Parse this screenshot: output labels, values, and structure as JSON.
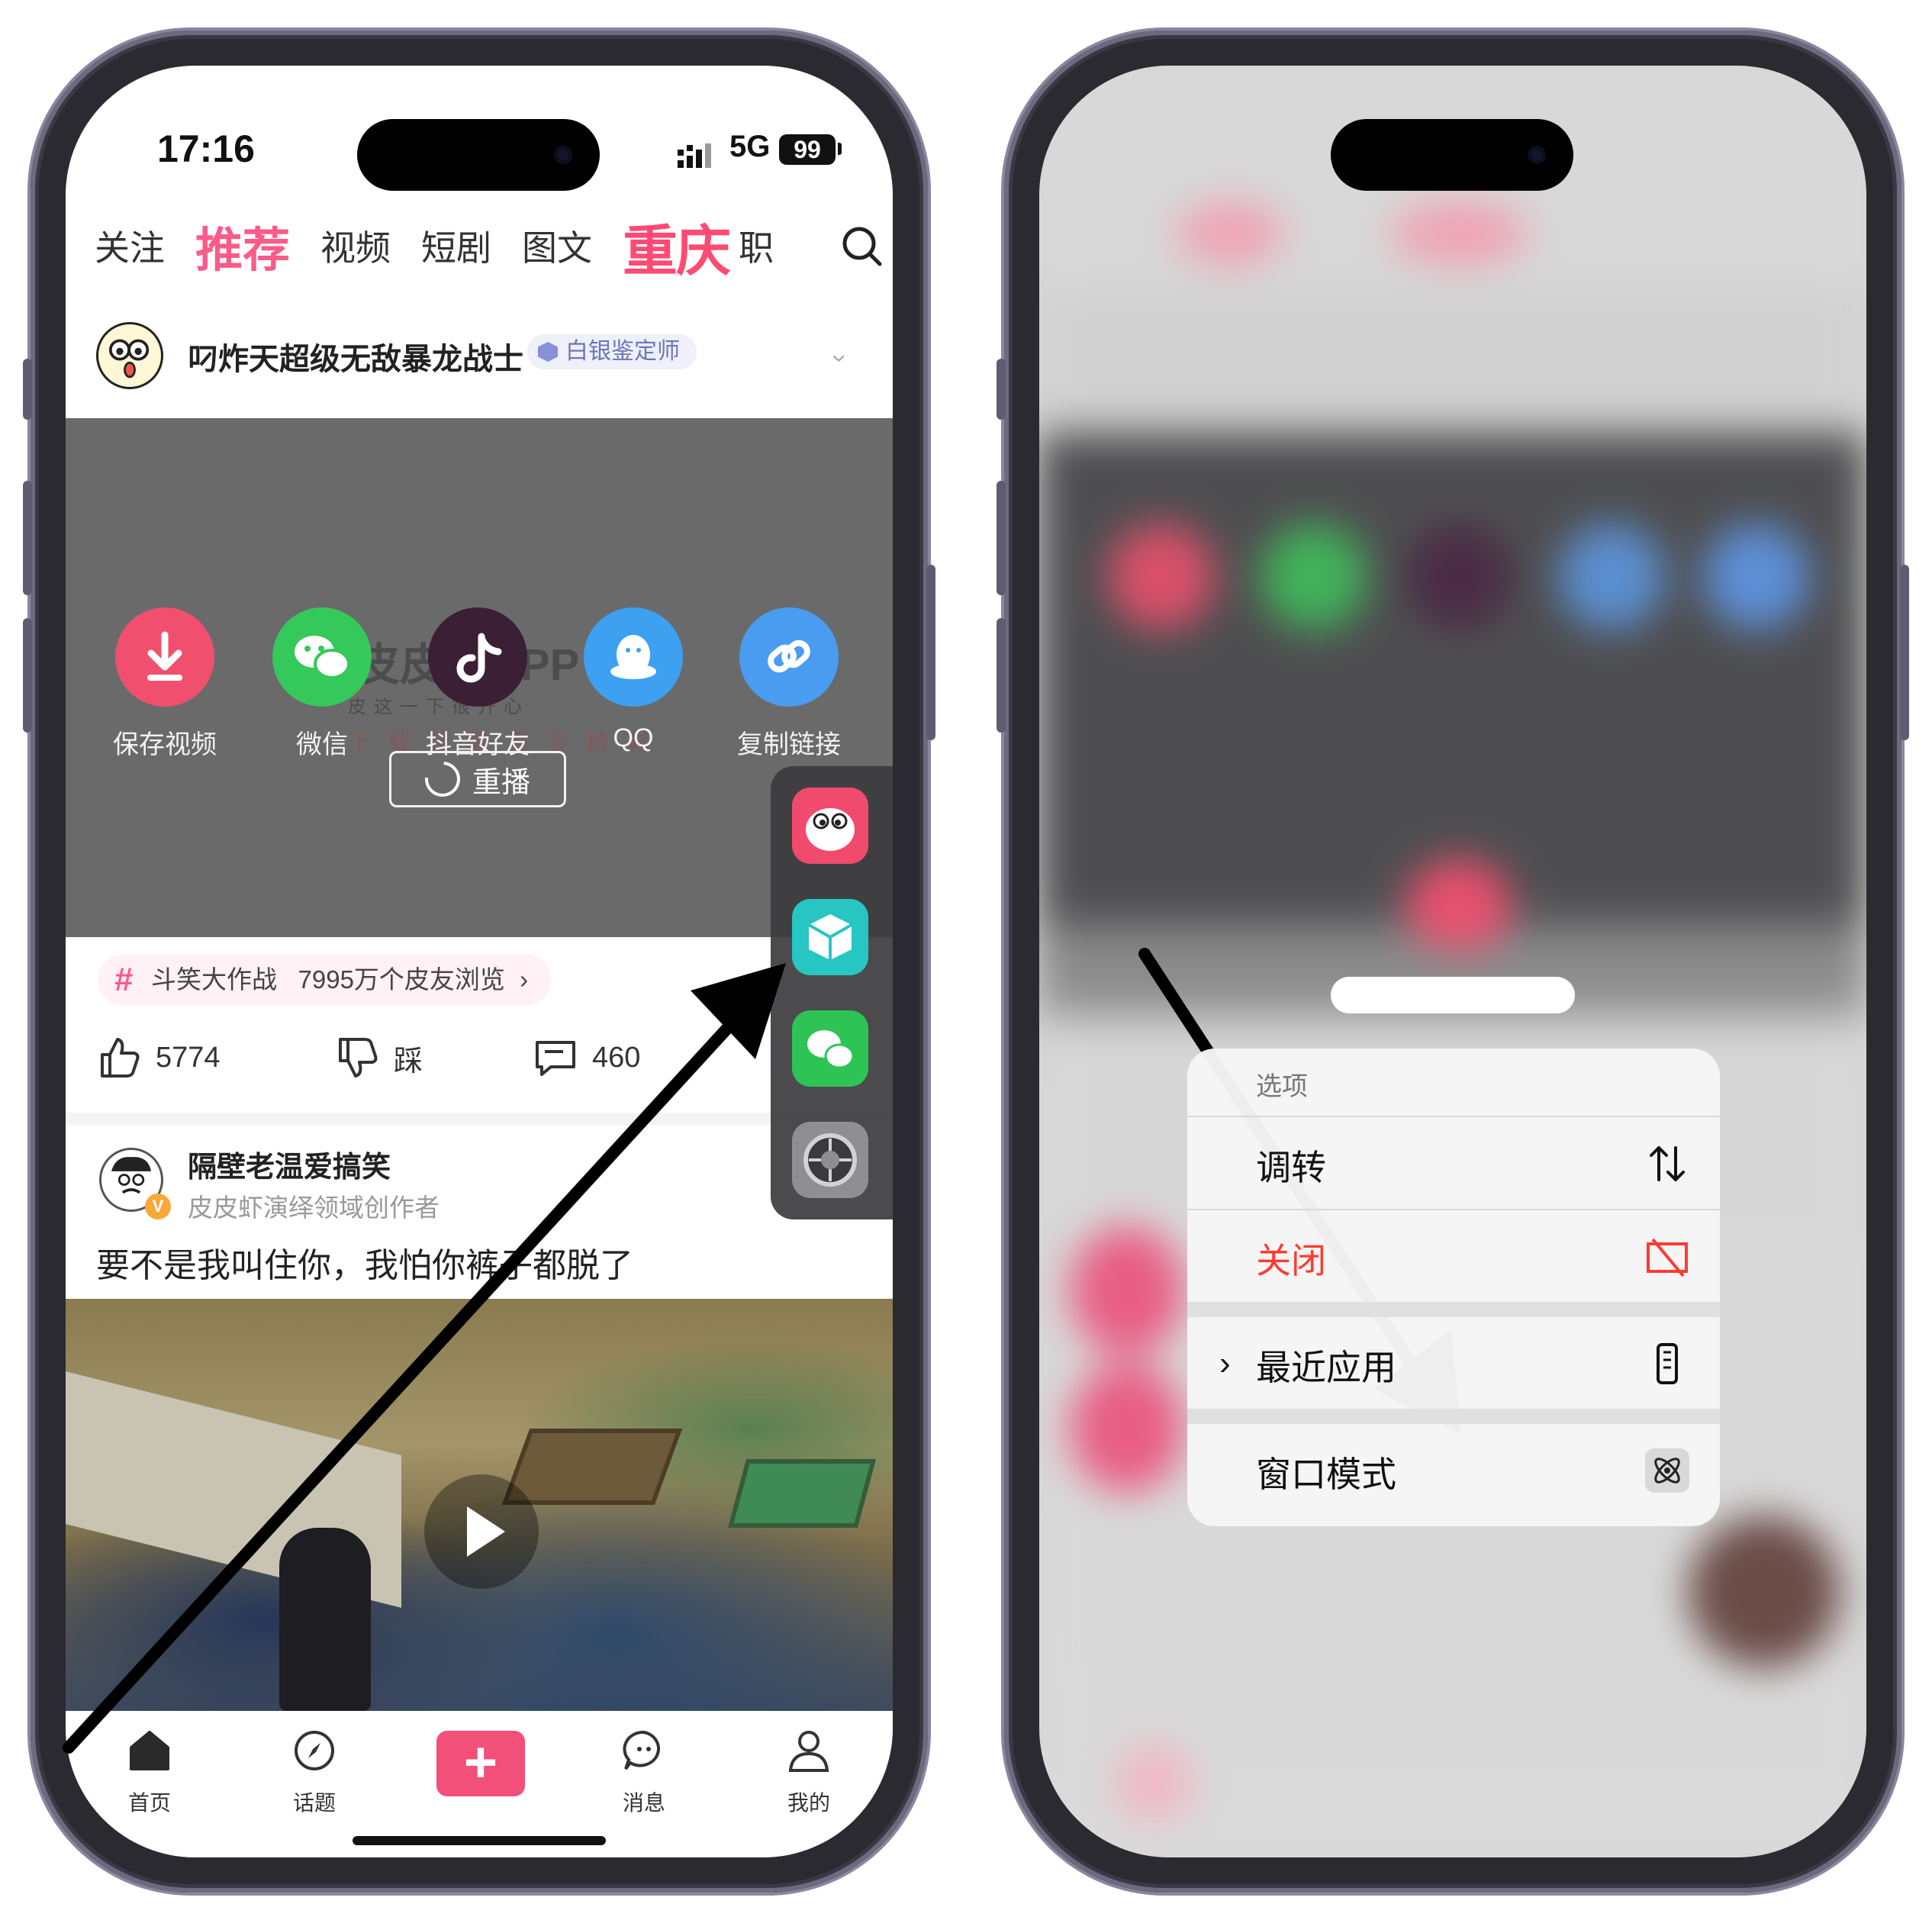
{
  "left_phone": {
    "status": {
      "time": "17:16",
      "network": "5G",
      "battery": "99"
    },
    "tabs": [
      {
        "label": "关注",
        "active": false
      },
      {
        "label": "推荐",
        "active": true
      },
      {
        "label": "视频",
        "active": false
      },
      {
        "label": "短剧",
        "active": false
      },
      {
        "label": "图文",
        "active": false
      },
      {
        "label": "重庆",
        "promo": true
      },
      {
        "label": "职",
        "active": false
      }
    ],
    "author": {
      "name": "叼炸天超级无敌暴龙战士",
      "badge": "白银鉴定师"
    },
    "share_panel": {
      "items": [
        {
          "label": "保存视频",
          "icon": "download-icon",
          "color": "#f0506e"
        },
        {
          "label": "微信",
          "icon": "wechat-icon",
          "color": "#35c85a"
        },
        {
          "label": "抖音好友",
          "icon": "douyin-icon",
          "color": "#3b1f34"
        },
        {
          "label": "QQ",
          "icon": "qq-icon",
          "color": "#3ea0f0"
        },
        {
          "label": "复制链接",
          "icon": "link-icon",
          "color": "#4a9cf0"
        }
      ],
      "watermark": "皮皮虾APP",
      "watermark_tagline": "皮这一下很开心",
      "watermark_cta": "下载获取更多精彩",
      "replay_label": "重播"
    },
    "topic": {
      "name": "斗笑大作战",
      "views": "7995万个皮友浏览",
      "chevron": "›"
    },
    "actions": {
      "likes": "5774",
      "dislike_label": "踩",
      "comments": "460"
    },
    "post": {
      "author": "隔壁老温爱搞笑",
      "role": "皮皮虾演绎领域创作者",
      "verified": "V",
      "text": "要不是我叫住你，我怕你裤子都脱了"
    },
    "bottom_nav": [
      {
        "label": "首页",
        "icon": "home-icon"
      },
      {
        "label": "话题",
        "icon": "compass-icon"
      },
      {
        "label": "+",
        "icon": "plus-icon"
      },
      {
        "label": "消息",
        "icon": "chat-icon"
      },
      {
        "label": "我的",
        "icon": "profile-icon"
      }
    ],
    "dock_apps": [
      {
        "name": "pipixia-app-icon",
        "color": "#f04a6c"
      },
      {
        "name": "cube-app-icon",
        "color": "#27c6c2"
      },
      {
        "name": "wechat-app-icon",
        "color": "#2ec455"
      },
      {
        "name": "settings-app-icon",
        "color": "#8e8e93"
      }
    ]
  },
  "right_phone": {
    "menu": {
      "header": "选项",
      "items": [
        {
          "label": "调转",
          "icon": "swap-vertical-icon",
          "color": "#111111"
        },
        {
          "label": "关闭",
          "icon": "close-window-icon",
          "color": "#ff3b30"
        },
        {
          "label": "最近应用",
          "icon": "phone-icon",
          "color": "#111111",
          "submenu": true
        },
        {
          "label": "窗口模式",
          "icon": "atom-icon",
          "color": "#111111"
        }
      ]
    }
  },
  "colors": {
    "accent": "#fb5b89",
    "promo": "#ff4b73",
    "destructive": "#ff3b30",
    "arrow": "#000000"
  }
}
